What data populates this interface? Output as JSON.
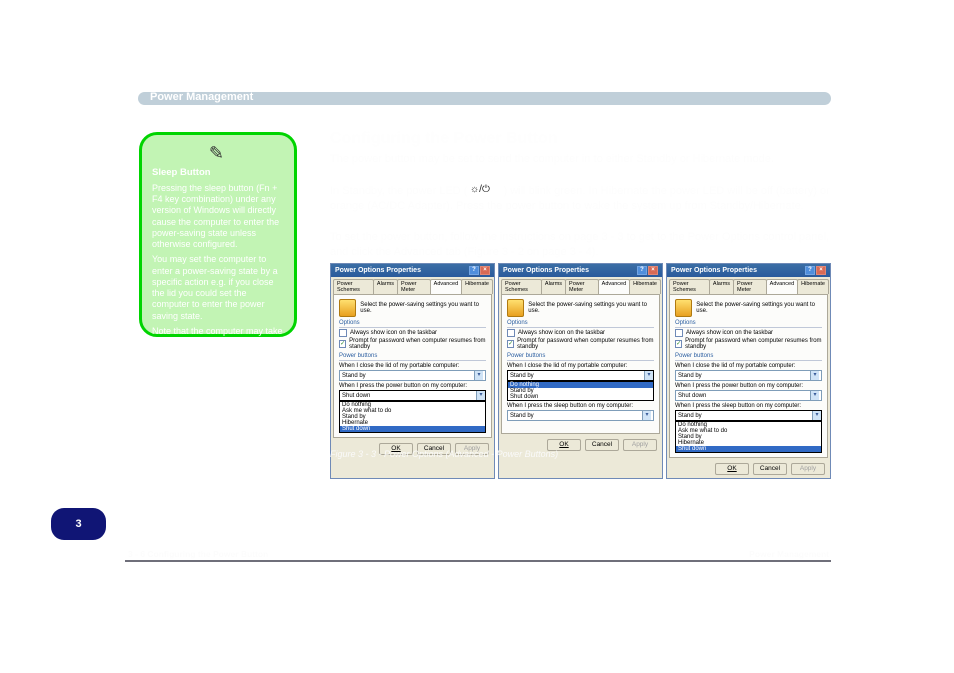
{
  "header": {
    "title": "Power Management"
  },
  "note": {
    "title": "Sleep Button",
    "p1": "Pressing the sleep button (Fn + F4 key combination) under any version of Windows will directly cause the computer to enter the power-saving state unless otherwise configured.",
    "p2": "You may set the computer to enter a power-saving state by a specific action e.g. if you close the lid you could set the computer to enter the power saving state.",
    "p3": "Note that the computer may take a few moments to actually enter the power-saving state as the system may need to save information, close down devices etc."
  },
  "main": {
    "section_title": "Configuring the Power Button",
    "p1": "The power button may be set to send the computer in to either Standby or Hibernate mode.",
    "p2_a": "In Standby, the power LED (",
    "p2_b": ") will blink green. In Hibernate the power LED will be off (battery) or orange (AC/DC Adapter). Press the power button to wake the system up from Standby/Hibernate.",
    "p3": "To set the power button, follow the instructions on page 3 - 3 to get to the Power Options control panel, and click the Advanced tab (Figure 3 - 2 on page 3 - 4)."
  },
  "dialog": {
    "title": "Power Options Properties",
    "tabs": [
      "Power Schemes",
      "Alarms",
      "Power Meter",
      "Advanced",
      "Hibernate"
    ],
    "active_tab": "Advanced",
    "desc": "Select the power-saving settings you want to use.",
    "options_group": "Options",
    "chk_taskbar": "Always show icon on the taskbar",
    "chk_pwd": "Prompt for password when computer resumes from standby",
    "power_buttons_group": "Power buttons",
    "lid_label": "When I close the lid of my portable computer:",
    "power_btn_label": "When I press the power button on my computer:",
    "sleep_btn_label": "When I press the sleep button on my computer:",
    "standby": "Stand by",
    "shutdown": "Shut down",
    "list_items": [
      "Do nothing",
      "Ask me what to do",
      "Stand by",
      "Hibernate",
      "Shut down"
    ],
    "list_items2": [
      "Do nothing",
      "Stand by",
      "Shut down"
    ],
    "btn_ok": "OK",
    "btn_cancel": "Cancel",
    "btn_apply": "Apply"
  },
  "figure": {
    "caption": "Figure 3 - 3  - Power Options (Advanced - Power Buttons)"
  },
  "footer": {
    "chapter": "3 - 6   Configuring the Power Button",
    "page_num": "3",
    "doc_title": "Power Management"
  }
}
